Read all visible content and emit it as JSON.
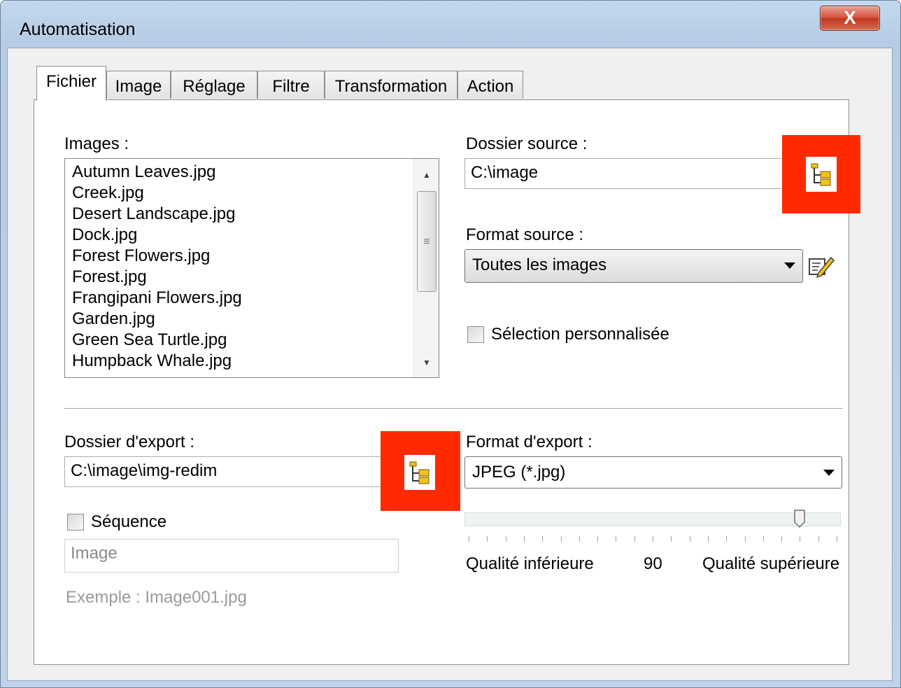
{
  "window": {
    "title": "Automatisation",
    "close_label": "X"
  },
  "tabs": [
    {
      "label": "Fichier",
      "active": true
    },
    {
      "label": "Image"
    },
    {
      "label": "Réglage"
    },
    {
      "label": "Filtre"
    },
    {
      "label": "Transformation"
    },
    {
      "label": "Action"
    }
  ],
  "images": {
    "label": "Images :",
    "items": [
      "Autumn Leaves.jpg",
      "Creek.jpg",
      "Desert Landscape.jpg",
      "Dock.jpg",
      "Forest Flowers.jpg",
      "Forest.jpg",
      "Frangipani Flowers.jpg",
      "Garden.jpg",
      "Green Sea Turtle.jpg",
      "Humpback Whale.jpg"
    ]
  },
  "source": {
    "folder_label": "Dossier source :",
    "folder_value": "C:\\image",
    "format_label": "Format source :",
    "format_value": "Toutes les images",
    "custom_selection_label": "Sélection personnalisée"
  },
  "export": {
    "folder_label": "Dossier d'export :",
    "folder_value": "C:\\image\\img-redim",
    "format_label": "Format d'export :",
    "format_value": "JPEG (*.jpg)",
    "sequence_label": "Séquence",
    "sequence_placeholder": "Image",
    "example_text": "Exemple : Image001.jpg",
    "quality_low_label": "Qualité inférieure",
    "quality_high_label": "Qualité supérieure",
    "quality_value": "90",
    "quality_fraction": 0.9
  },
  "colors": {
    "highlight_red": "#ff2a00",
    "folder_yellow": "#f2c21b"
  }
}
